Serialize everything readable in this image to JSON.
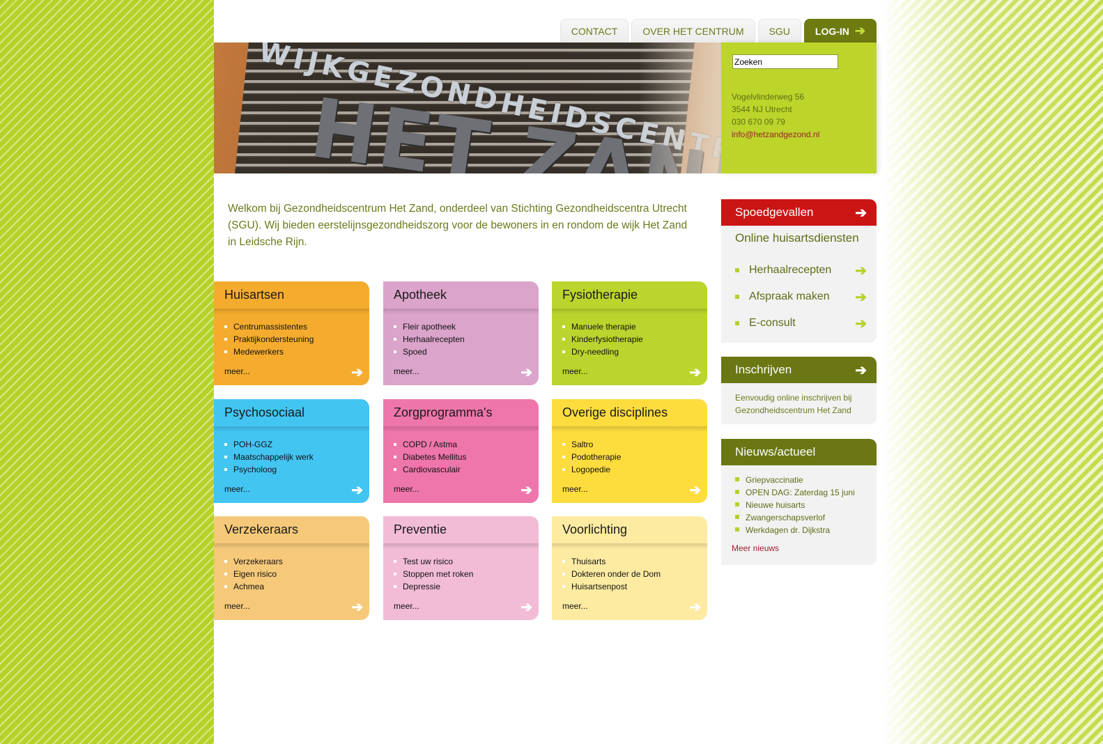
{
  "nav": {
    "tabs": [
      "CONTACT",
      "OVER HET CENTRUM",
      "SGU"
    ],
    "login": "LOG-IN"
  },
  "banner": {
    "line1": "WIJKGEZONDHEIDSCENTRUM",
    "line2": "HET ZAND"
  },
  "search": {
    "value": "Zoeken"
  },
  "address": {
    "street": "Vogelvlinderweg 56",
    "city": "3544 NJ Utrecht",
    "phone": "030 670 09 79",
    "email": "info@hetzandgezond.nl"
  },
  "intro": "Welkom bij Gezondheidscentrum Het Zand, onderdeel van Stichting Gezondheidscentra Utrecht (SGU). Wij bieden eerstelijnsgezondheidszorg voor de bewoners in en rondom de wijk Het Zand in Leidsche Rijn.",
  "tiles": [
    {
      "title": "Huisartsen",
      "items": [
        "Centrumassistentes",
        "Praktijkondersteuning",
        "Medewerkers"
      ],
      "more": "meer...",
      "color": "#f5ac2e"
    },
    {
      "title": "Apotheek",
      "items": [
        "Fleir apotheek",
        "Herhaalrecepten",
        "Spoed"
      ],
      "more": "meer...",
      "color": "#dba4cb"
    },
    {
      "title": "Fysiotherapie",
      "items": [
        "Manuele therapie",
        "Kinderfysiotherapie",
        "Dry-needling"
      ],
      "more": "meer...",
      "color": "#bcd52e"
    },
    {
      "title": "Psychosociaal",
      "items": [
        "POH-GGZ",
        "Maatschappelijk werk",
        "Psycholoog"
      ],
      "more": "meer...",
      "color": "#43c5f2"
    },
    {
      "title": "Zorgprogramma's",
      "items": [
        "COPD / Astma",
        "Diabetes Mellitus",
        "Cardiovasculair"
      ],
      "more": "meer...",
      "color": "#ee76ab"
    },
    {
      "title": "Overige disciplines",
      "items": [
        "Saltro",
        "Podotherapie",
        "Logopedie"
      ],
      "more": "meer...",
      "color": "#fddc3e"
    },
    {
      "title": "Verzekeraars",
      "items": [
        "Verzekeraars",
        "Eigen risico",
        "Achmea"
      ],
      "more": "meer...",
      "color": "#f6c97a"
    },
    {
      "title": "Preventie",
      "items": [
        "Test uw risico",
        "Stoppen met roken",
        "Depressie"
      ],
      "more": "meer...",
      "color": "#f2bcd6"
    },
    {
      "title": "Voorlichting",
      "items": [
        "Thuisarts",
        "Dokteren onder de Dom",
        "Huisartsenpost"
      ],
      "more": "meer...",
      "color": "#fdeba2"
    }
  ],
  "sidebar": {
    "spoed": "Spoedgevallen",
    "online_title": "Online huisartsdiensten",
    "online_items": [
      "Herhaalrecepten",
      "Afspraak maken",
      "E-consult"
    ],
    "inschrijven_title": "Inschrijven",
    "inschrijven_text": "Eenvoudig online inschrijven bij Gezondheidscentrum Het Zand",
    "nieuws_title": "Nieuws/actueel",
    "nieuws_items": [
      "Griepvaccinatie",
      "OPEN DAG: Zaterdag 15 juni",
      "Nieuwe huisarts",
      "Zwangerschapsverlof",
      "Werkdagen dr. Dijkstra"
    ],
    "nieuws_more": "Meer nieuws"
  }
}
